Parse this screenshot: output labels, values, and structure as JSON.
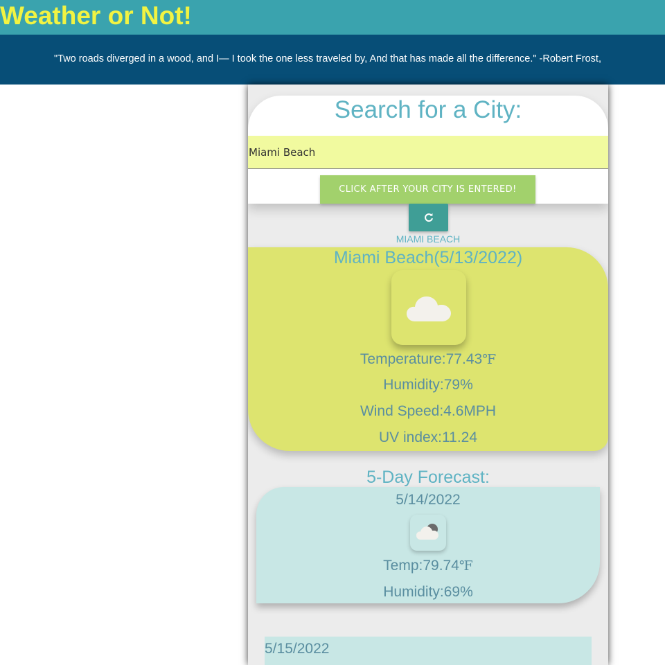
{
  "header": {
    "title": "Weather or Not!",
    "quote": "\"Two roads diverged in a wood, and I— I took the one less traveled by, And that has made all the difference.\" -Robert Frost,"
  },
  "search": {
    "title": "Search for a City:",
    "input_value": "Miami Beach",
    "submit_label": "CLICK AFTER YOUR CITY IS ENTERED!",
    "refresh_icon": "refresh-icon"
  },
  "history": [
    "MIAMI BEACH"
  ],
  "current": {
    "title": "Miami Beach(5/13/2022)",
    "icon": "cloud-icon",
    "temperature_label": "Temperature:",
    "temperature_value": "77.43",
    "humidity": "Humidity:79%",
    "wind": "Wind Speed:4.6MPH",
    "uv": "UV index:11.24"
  },
  "unit_symbol": "℉",
  "forecast": {
    "title": "5-Day Forecast:",
    "days": [
      {
        "date": "5/14/2022",
        "icon": "partly-cloudy-icon",
        "temp_label": "Temp:",
        "temp_value": "79.74",
        "humidity": "Humidity:69%"
      },
      {
        "date": "5/15/2022"
      }
    ]
  },
  "colors": {
    "header_bg": "#3aa3ae",
    "title_yellow": "#f1f342",
    "quote_bg": "#074e77",
    "current_card": "#dde46f",
    "forecast_card": "#c8e7e5",
    "button_green": "#a2d16c",
    "refresh_teal": "#3f9e96",
    "accent_text": "#5fb3c3"
  }
}
